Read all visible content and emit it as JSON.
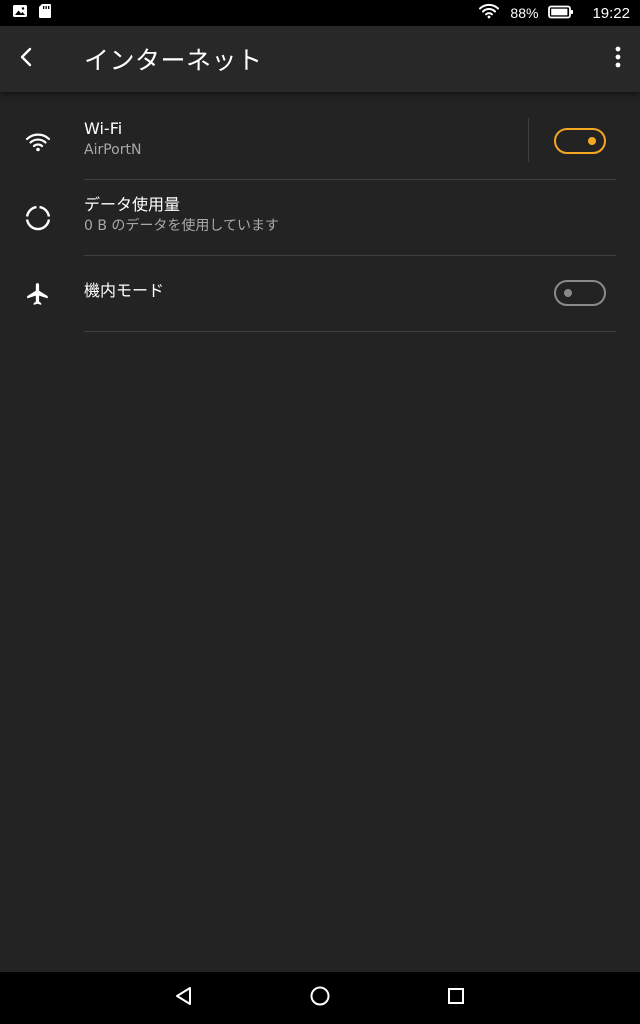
{
  "status_bar": {
    "battery": "88%",
    "time": "19:22",
    "icons": [
      "image-notification-icon",
      "sd-card-icon",
      "wifi-signal-icon",
      "battery-icon"
    ]
  },
  "app_bar": {
    "title": "インターネット",
    "icons": [
      "back-arrow-icon",
      "overflow-menu-icon"
    ]
  },
  "items": [
    {
      "title": "Wi-Fi",
      "subtitle": "AirPortN",
      "icon": "wifi-icon",
      "toggle_on": true
    },
    {
      "title": "データ使用量",
      "subtitle": "0 B のデータを使用しています",
      "icon": "data-usage-icon"
    },
    {
      "title": "機内モード",
      "icon": "airplane-icon",
      "toggle_on": false
    }
  ],
  "nav_bar": {
    "icons": [
      "nav-back-icon",
      "nav-home-icon",
      "nav-recents-icon"
    ]
  },
  "colors": {
    "accent": "#f5a623",
    "background": "#232323",
    "app_bar": "#282828",
    "toggle_off": "#8a8a8a"
  }
}
